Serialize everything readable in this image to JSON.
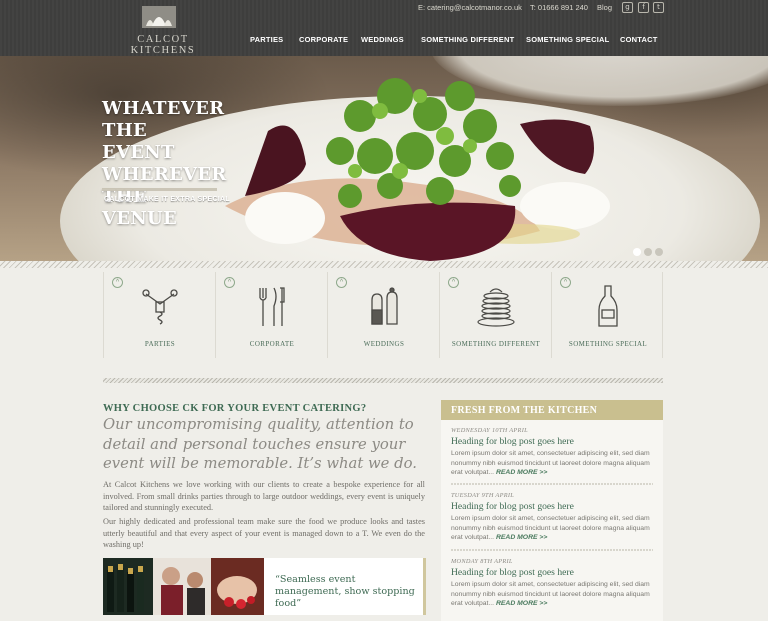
{
  "header": {
    "logo_text": "CALCOT KITCHENS",
    "email": "E: catering@calcotmanor.co.uk",
    "phone": "T: 01666 891 240",
    "blog": "Blog",
    "social": [
      {
        "icon": "google-plus-icon",
        "glyph": "g"
      },
      {
        "icon": "facebook-icon",
        "glyph": "f"
      },
      {
        "icon": "twitter-icon",
        "glyph": "t"
      }
    ],
    "nav": [
      "PARTIES",
      "CORPORATE",
      "WEDDINGS",
      "SOMETHING DIFFERENT",
      "SOMETHING SPECIAL",
      "CONTACT"
    ]
  },
  "hero": {
    "title_lines": [
      "WHATEVER",
      "THE EVENT",
      "WHEREVER",
      "THE VENUE"
    ],
    "subtitle": "CALCOT MAKE IT EXTRA SPECIAL",
    "slides": 3,
    "active_slide": 1
  },
  "categories": [
    {
      "label": "PARTIES",
      "icon": "corkscrew-icon"
    },
    {
      "label": "CORPORATE",
      "icon": "cutlery-icon"
    },
    {
      "label": "WEDDINGS",
      "icon": "salt-pepper-icon"
    },
    {
      "label": "SOMETHING DIFFERENT",
      "icon": "pancake-stack-icon"
    },
    {
      "label": "SOMETHING SPECIAL",
      "icon": "bottle-icon"
    }
  ],
  "main": {
    "heading": "WHY CHOOSE CK FOR YOUR EVENT CATERING?",
    "lead": "Our uncompromising quality, attention to detail and personal touches ensure your event will be memorable. It’s what we do.",
    "para1": "At Calcot Kitchens we love working with our clients to create a bespoke experience for all involved. From small drinks parties through to large outdoor weddings, every event is uniquely tailored and stunningly executed.",
    "para2": "Our highly dedicated and professional team make sure the food we produce looks and tastes utterly beautiful and that every aspect of your event is managed down to a T. We even do the washing up!",
    "quote": "“Seamless event management, show stopping food”"
  },
  "sidebar": {
    "title": "FRESH FROM THE KITCHEN",
    "posts": [
      {
        "date": "WEDNESDAY 10TH APRIL",
        "title": "Heading for blog post goes here",
        "excerpt": "Lorem ipsum dolor sit amet, consectetuer adipiscing elit, sed diam nonummy nibh euismod tincidunt ut laoreet dolore magna aliquam erat volutpat...",
        "more": "READ MORE >>"
      },
      {
        "date": "TUESDAY 9TH APRIL",
        "title": "Heading for blog post goes here",
        "excerpt": "Lorem ipsum dolor sit amet, consectetuer adipiscing elit, sed diam nonummy nibh euismod tincidunt ut laoreet dolore magna aliquam erat volutpat...",
        "more": "READ MORE >>"
      },
      {
        "date": "MONDAY 8TH APRIL",
        "title": "Heading for blog post goes here",
        "excerpt": "Lorem ipsum dolor sit amet, consectetuer adipiscing elit, sed diam nonummy nibh euismod tincidunt ut laoreet dolore magna aliquam erat volutpat...",
        "more": "READ MORE >>"
      }
    ]
  },
  "colors": {
    "header_bg": "#3f3f3e",
    "accent_green": "#3e6a53",
    "sidebar_gold": "#c9bf8f",
    "page_bg": "#efeee9"
  }
}
